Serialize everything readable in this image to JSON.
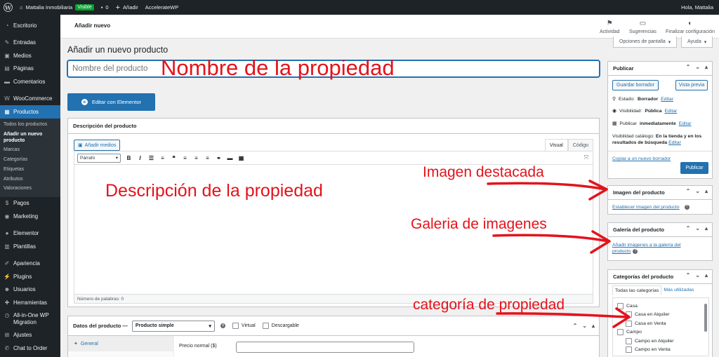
{
  "admin_bar": {
    "site_name": "Mattalia Inmobiliaria",
    "visibility_badge": "Visible",
    "comments_count": "0",
    "add_new": "Añadir",
    "plugin": "AccelerateWP",
    "greeting": "Hola, Mattalia"
  },
  "sidebar": {
    "items": [
      {
        "label": "Escritorio",
        "icon": "dashboard-icon"
      },
      {
        "label": "Entradas",
        "icon": "pin-icon"
      },
      {
        "label": "Medios",
        "icon": "media-icon"
      },
      {
        "label": "Páginas",
        "icon": "pages-icon"
      },
      {
        "label": "Comentarios",
        "icon": "comments-icon"
      },
      {
        "label": "WooCommerce",
        "icon": "woocommerce-icon"
      },
      {
        "label": "Productos",
        "icon": "products-icon"
      },
      {
        "label": "Pagos",
        "icon": "payments-icon"
      },
      {
        "label": "Marketing",
        "icon": "marketing-icon"
      },
      {
        "label": "Elementor",
        "icon": "elementor-icon"
      },
      {
        "label": "Plantillas",
        "icon": "templates-icon"
      },
      {
        "label": "Apariencia",
        "icon": "appearance-icon"
      },
      {
        "label": "Plugins",
        "icon": "plugins-icon"
      },
      {
        "label": "Usuarios",
        "icon": "users-icon"
      },
      {
        "label": "Herramientas",
        "icon": "tools-icon"
      },
      {
        "label": "All-in-One WP Migration",
        "icon": "migration-icon"
      },
      {
        "label": "Ajustes",
        "icon": "settings-icon"
      },
      {
        "label": "Chat to Order",
        "icon": "chat-icon"
      }
    ],
    "submenu": [
      "Todos los productos",
      "Añadir un nuevo producto",
      "Marcas",
      "Categorías",
      "Etiquetas",
      "Atributos",
      "Valoraciones"
    ]
  },
  "topbar": {
    "title": "Añadir nuevo",
    "activity": "Actividad",
    "suggestions": "Sugerencias",
    "finish_setup": "Finalizar configuración",
    "screen_options": "Opciones de pantalla",
    "help": "Ayuda"
  },
  "main": {
    "page_title": "Añadir un nuevo producto",
    "title_placeholder": "Nombre del producto",
    "elementor_button": "Editar con Elementor",
    "description_title": "Descripción del producto",
    "add_media": "Añadir medios",
    "tab_visual": "Visual",
    "tab_code": "Código",
    "format_select": "Párrafo",
    "word_count": "Número de palabras: 0"
  },
  "product_data": {
    "title": "Datos del producto —",
    "type": "Producto simple",
    "virtual": "Virtual",
    "downloadable": "Descargable",
    "tab_general": "General",
    "regular_price_label": "Precio normal ($)"
  },
  "publish": {
    "title": "Publicar",
    "save_draft": "Guardar borrador",
    "preview": "Vista previa",
    "status_label": "Estado:",
    "status_value": "Borrador",
    "visibility_label": "Visibilidad:",
    "visibility_value": "Pública",
    "publish_label": "Publicar",
    "publish_value": "inmediatamente",
    "catalog_label": "Visibilidad catálogo:",
    "catalog_value": "En la tienda y en los resultados de búsqueda",
    "edit": "Editar",
    "copy_draft": "Copiar a un nuevo borrador",
    "publish_button": "Publicar"
  },
  "product_image": {
    "title": "Imagen del producto",
    "link": "Establecer imagen del producto"
  },
  "gallery": {
    "title": "Galería del producto",
    "link": "Añadir imágenes a la galería del producto"
  },
  "categories": {
    "title": "Categorías del producto",
    "tab_all": "Todas las categorías",
    "tab_most_used": "Más utilizadas",
    "items": [
      {
        "label": "Casa",
        "level": 0
      },
      {
        "label": "Casa en Alquiler",
        "level": 1
      },
      {
        "label": "Casa en Venta",
        "level": 1
      },
      {
        "label": "Campo",
        "level": 0
      },
      {
        "label": "Campo en Alquiler",
        "level": 1
      },
      {
        "label": "Campo en Venta",
        "level": 1
      }
    ]
  },
  "annotations": {
    "title_note": "Nombre de la propiedad",
    "description_note": "Descripción de la propiedad",
    "featured_note": "Imagen destacada",
    "gallery_note": "Galeria de imagenes",
    "category_note": "categoría de propiedad",
    "color": "#e3131b"
  }
}
